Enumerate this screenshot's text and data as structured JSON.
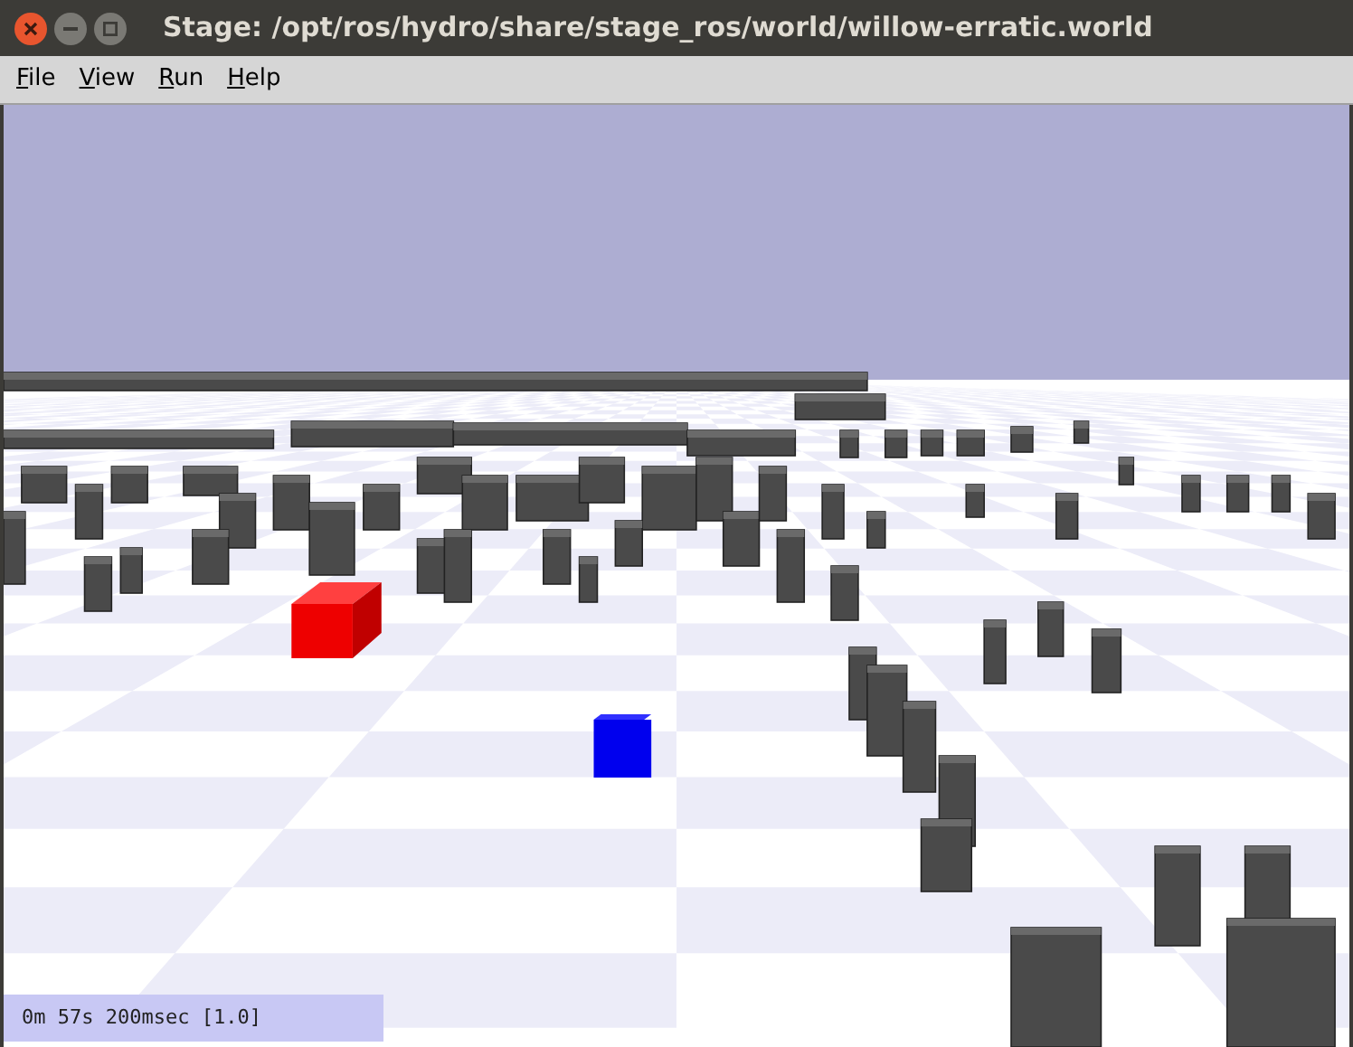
{
  "window": {
    "title": "Stage: /opt/ros/hydro/share/stage_ros/world/willow-erratic.world"
  },
  "menu": [
    {
      "label": "File"
    },
    {
      "label": "View"
    },
    {
      "label": "Run"
    },
    {
      "label": "Help"
    }
  ],
  "status_bar": {
    "text": "0m 57s 200msec [1.0]"
  }
}
